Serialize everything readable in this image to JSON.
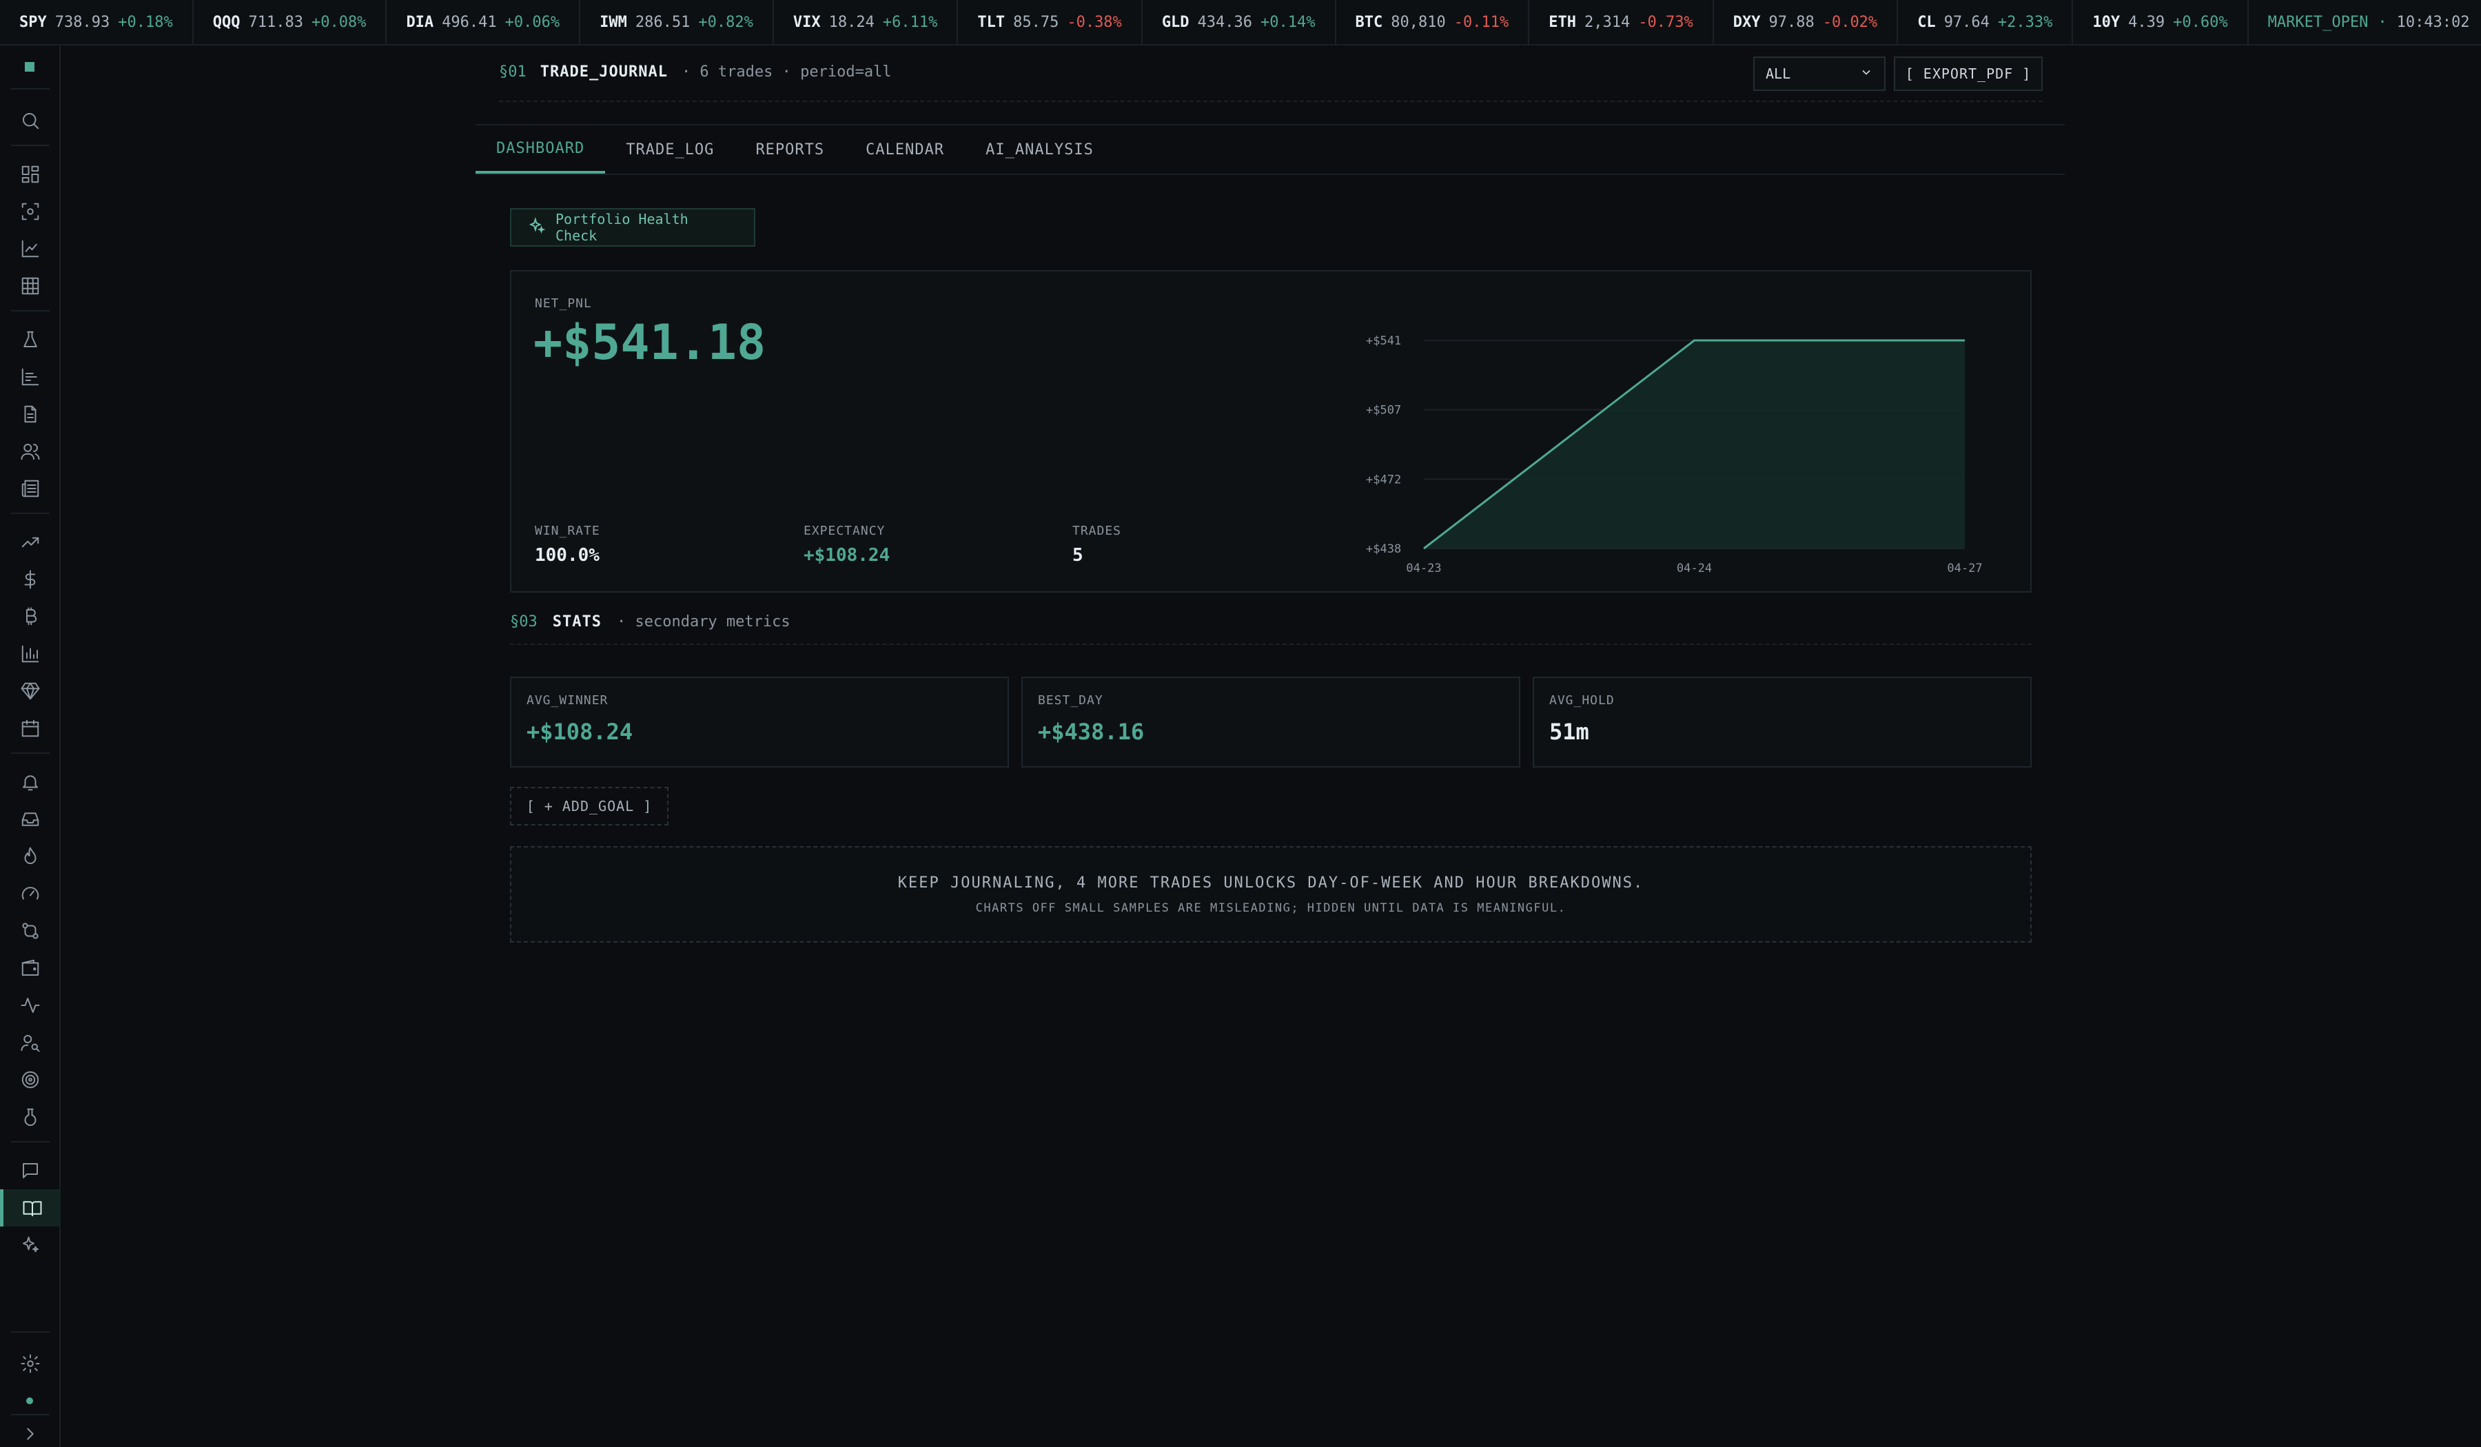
{
  "ticker": [
    {
      "sym": "SPY",
      "px": "738.93",
      "chg": "+0.18%",
      "dir": "up"
    },
    {
      "sym": "QQQ",
      "px": "711.83",
      "chg": "+0.08%",
      "dir": "up"
    },
    {
      "sym": "DIA",
      "px": "496.41",
      "chg": "+0.06%",
      "dir": "up"
    },
    {
      "sym": "IWM",
      "px": "286.51",
      "chg": "+0.82%",
      "dir": "up"
    },
    {
      "sym": "VIX",
      "px": "18.24",
      "chg": "+6.11%",
      "dir": "up"
    },
    {
      "sym": "TLT",
      "px": "85.75",
      "chg": "-0.38%",
      "dir": "down"
    },
    {
      "sym": "GLD",
      "px": "434.36",
      "chg": "+0.14%",
      "dir": "up"
    },
    {
      "sym": "BTC",
      "px": "80,810",
      "chg": "-0.11%",
      "dir": "down"
    },
    {
      "sym": "ETH",
      "px": "2,314",
      "chg": "-0.73%",
      "dir": "down"
    },
    {
      "sym": "DXY",
      "px": "97.88",
      "chg": "-0.02%",
      "dir": "down"
    },
    {
      "sym": "CL",
      "px": "97.64",
      "chg": "+2.33%",
      "dir": "up"
    },
    {
      "sym": "10Y",
      "px": "4.39",
      "chg": "+0.60%",
      "dir": "up"
    }
  ],
  "market_status": {
    "label": "MARKET_OPEN",
    "sep": "·",
    "time": "10:43:02"
  },
  "header": {
    "section_num": "§01",
    "title": "TRADE_JOURNAL",
    "meta": "· 6 trades · period=all",
    "period_value": "ALL",
    "export_label": "[ EXPORT_PDF ]"
  },
  "tabs": [
    {
      "label": "DASHBOARD",
      "active": true
    },
    {
      "label": "TRADE_LOG",
      "active": false
    },
    {
      "label": "REPORTS",
      "active": false
    },
    {
      "label": "CALENDAR",
      "active": false
    },
    {
      "label": "AI_ANALYSIS",
      "active": false
    }
  ],
  "health_button": "Portfolio Health Check",
  "pnl": {
    "label": "NET_PNL",
    "value": "+$541.18",
    "win_rate_label": "WIN_RATE",
    "win_rate": "100.0%",
    "expectancy_label": "EXPECTANCY",
    "expectancy": "+$108.24",
    "trades_label": "TRADES",
    "trades": "5"
  },
  "chart_data": {
    "type": "area",
    "x": [
      "04-23",
      "04-24",
      "04-27"
    ],
    "values": [
      438,
      541,
      541
    ],
    "y_ticks": [
      "+$541",
      "+$507",
      "+$472",
      "+$438"
    ],
    "x_ticks": [
      "04-23",
      "04-24",
      "04-27"
    ],
    "ylim": [
      438,
      541
    ],
    "grid": true,
    "accent": "#4fa893"
  },
  "stats": {
    "section_num": "§03",
    "title": "STATS",
    "meta": "· secondary metrics",
    "cards": [
      {
        "label": "AVG_WINNER",
        "value": "+$108.24",
        "tone": "up"
      },
      {
        "label": "BEST_DAY",
        "value": "+$438.16",
        "tone": "up"
      },
      {
        "label": "AVG_HOLD",
        "value": "51m",
        "tone": "neutral"
      }
    ]
  },
  "goal_button": "[ + ADD_GOAL ]",
  "notice": {
    "line1": "KEEP JOURNALING, 4 MORE TRADES UNLOCKS DAY-OF-WEEK AND HOUR BREAKDOWNS.",
    "line2": "CHARTS OFF SMALL SAMPLES ARE MISLEADING; HIDDEN UNTIL DATA IS MEANINGFUL."
  },
  "sidebar_icons": [
    "search-icon",
    "dashboard-icon",
    "scanner-icon",
    "chart-line-icon",
    "grid-icon",
    "flask-icon",
    "bar-chart-icon",
    "document-icon",
    "users-icon",
    "news-icon",
    "trend-up-icon",
    "dollar-icon",
    "bitcoin-icon",
    "column-chart-icon",
    "gem-icon",
    "calendar-icon",
    "bell-icon",
    "inbox-icon",
    "flame-icon",
    "gauge-icon",
    "git-compare-icon",
    "wallet-icon",
    "pulse-icon",
    "user-search-icon",
    "target-icon",
    "beaker-icon",
    "chat-icon",
    "book-open-icon",
    "sparkles-icon",
    "gear-icon",
    "chevron-right-icon"
  ],
  "colors": {
    "accent": "#4fa893",
    "down": "#e05a52",
    "bg": "#0b0d10"
  }
}
